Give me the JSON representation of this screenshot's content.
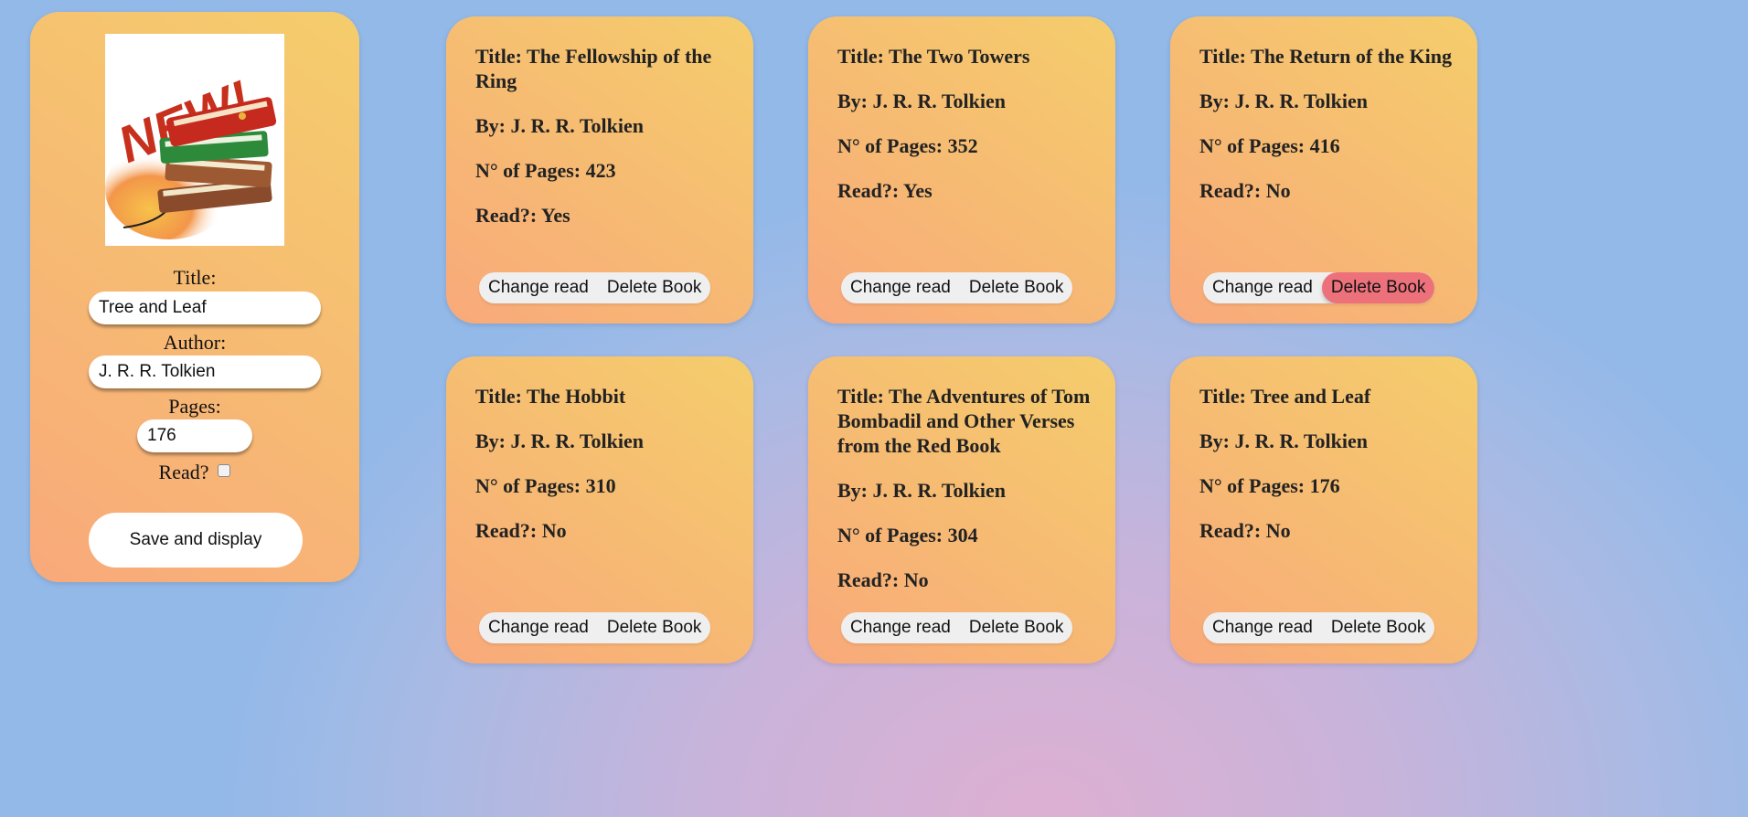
{
  "form": {
    "logo_icon": "new-books-stack-icon",
    "logo_text": "NEW!",
    "title_label": "Title:",
    "title_value": "Tree and Leaf",
    "author_label": "Author:",
    "author_value": "J. R. R. Tolkien",
    "pages_label": "Pages:",
    "pages_value": "176",
    "read_label": "Read?",
    "read_checked": false,
    "save_label": "Save and display"
  },
  "books": [
    {
      "title": "Title: The Fellowship of the Ring",
      "author": "By: J. R. R. Tolkien",
      "pages": "N° of Pages: 423",
      "read": "Read?: Yes",
      "change_label": "Change read",
      "delete_label": "Delete Book"
    },
    {
      "title": "Title: The Two Towers",
      "author": "By: J. R. R. Tolkien",
      "pages": "N° of Pages: 352",
      "read": "Read?: Yes",
      "change_label": "Change read",
      "delete_label": "Delete Book"
    },
    {
      "title": "Title: The Return of the King",
      "author": "By: J. R. R. Tolkien",
      "pages": "N° of Pages: 416",
      "read": "Read?: No",
      "change_label": "Change read",
      "delete_label": "Delete Book"
    },
    {
      "title": "Title: The Hobbit",
      "author": "By: J. R. R. Tolkien",
      "pages": "N° of Pages: 310",
      "read": "Read?: No",
      "change_label": "Change read",
      "delete_label": "Delete Book"
    },
    {
      "title": "Title: The Adventures of Tom Bombadil and Other Verses from the Red Book",
      "author": "By: J. R. R. Tolkien",
      "pages": "N° of Pages: 304",
      "read": "Read?: No",
      "change_label": "Change read",
      "delete_label": "Delete Book"
    },
    {
      "title": "Title: Tree and Leaf",
      "author": "By: J. R. R. Tolkien",
      "pages": "N° of Pages: 176",
      "read": "Read?: No",
      "change_label": "Change read",
      "delete_label": "Delete Book"
    }
  ],
  "colors": {
    "card_gradient_start": "#f9a97a",
    "card_gradient_end": "#f5cd6c",
    "delete_hover": "#ec717b",
    "background_center": "#ddb0d2",
    "background_edge": "#93b9e9"
  }
}
